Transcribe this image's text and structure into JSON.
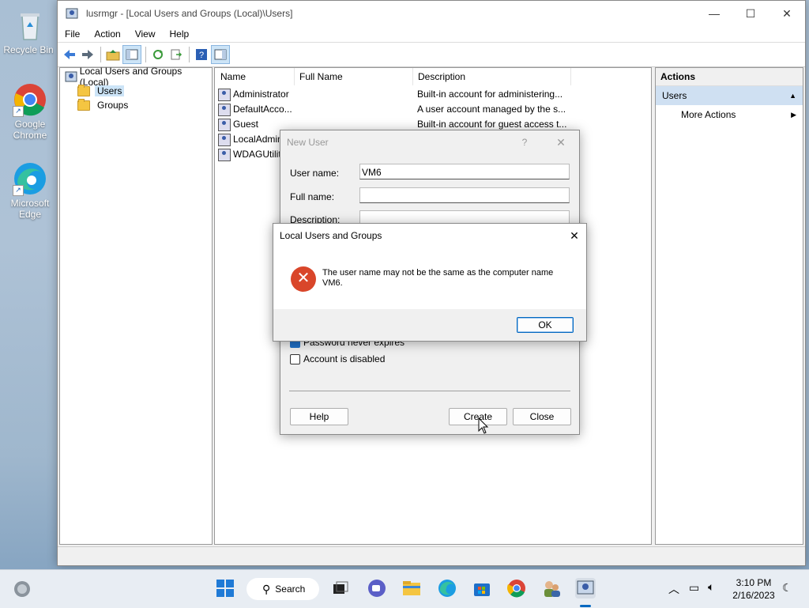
{
  "desktop": {
    "icons": [
      {
        "label": "Recycle Bin"
      },
      {
        "label": "Google Chrome"
      },
      {
        "label": "Microsoft Edge"
      }
    ]
  },
  "window": {
    "title": "lusrmgr - [Local Users and Groups (Local)\\Users]",
    "menu": [
      "File",
      "Action",
      "View",
      "Help"
    ],
    "tree": {
      "root": "Local Users and Groups (Local)",
      "items": [
        "Users",
        "Groups"
      ],
      "selected": "Users"
    },
    "list": {
      "columns": [
        "Name",
        "Full Name",
        "Description"
      ],
      "rows": [
        {
          "name": "Administrator",
          "full_name": "",
          "description": "Built-in account for administering..."
        },
        {
          "name": "DefaultAcco...",
          "full_name": "",
          "description": "A user account managed by the s..."
        },
        {
          "name": "Guest",
          "full_name": "",
          "description": "Built-in account for guest access t..."
        },
        {
          "name": "LocalAdmin",
          "full_name": "",
          "description": ""
        },
        {
          "name": "WDAGUtilit",
          "full_name": "",
          "description": ""
        }
      ]
    },
    "actions": {
      "header": "Actions",
      "section": "Users",
      "items": [
        "More Actions"
      ]
    }
  },
  "new_user_dialog": {
    "title": "New User",
    "help_glyph": "?",
    "fields": {
      "user_name_label": "User name:",
      "user_name_value": "VM6",
      "full_name_label": "Full name:",
      "full_name_value": "",
      "description_label": "Description:"
    },
    "checkboxes": [
      {
        "label": "Password never expires",
        "checked": true
      },
      {
        "label": "Account is disabled",
        "checked": false
      }
    ],
    "buttons": {
      "help": "Help",
      "create": "Create",
      "close": "Close"
    }
  },
  "error_dialog": {
    "title": "Local Users and Groups",
    "message_line1": "The user name may not be the same as the computer name",
    "message_line2": "VM6.",
    "ok": "OK"
  },
  "taskbar": {
    "search_label": "Search",
    "time": "3:10 PM",
    "date": "2/16/2023"
  },
  "colors": {
    "accent": "#0067c0",
    "error": "#d9462a",
    "selection": "#cce4f7"
  }
}
